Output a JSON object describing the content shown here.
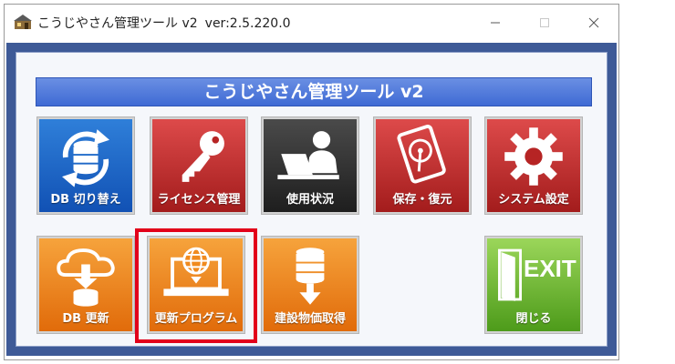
{
  "window": {
    "title": "こうじやさん管理ツール v2",
    "version": "ver:2.5.220.0",
    "controls": {
      "minimize": "—",
      "maximize": "☐",
      "close": "✕"
    }
  },
  "header": {
    "title": "こうじやさん管理ツール v2"
  },
  "tiles": [
    {
      "label": "DB 切り替え",
      "color": "#1a62c4",
      "icon": "database-refresh-icon"
    },
    {
      "label": "ライセンス管理",
      "color": "#c0282a",
      "icon": "key-icon"
    },
    {
      "label": "使用状況",
      "color": "#2d2d2d",
      "icon": "user-laptop-icon"
    },
    {
      "label": "保存・復元",
      "color": "#c0282a",
      "icon": "hard-drive-icon"
    },
    {
      "label": "システム設定",
      "color": "#c0282a",
      "icon": "gear-icon"
    },
    {
      "label": "DB 更新",
      "color": "#f08a1e",
      "icon": "cloud-download-icon"
    },
    {
      "label": "更新プログラム",
      "color": "#f08a1e",
      "icon": "globe-laptop-icon"
    },
    {
      "label": "建設物価取得",
      "color": "#f08a1e",
      "icon": "database-download-icon"
    },
    {
      "label": "閉じる",
      "color": "#6fb630",
      "icon": "exit-door-icon",
      "badge": "EXIT"
    }
  ]
}
